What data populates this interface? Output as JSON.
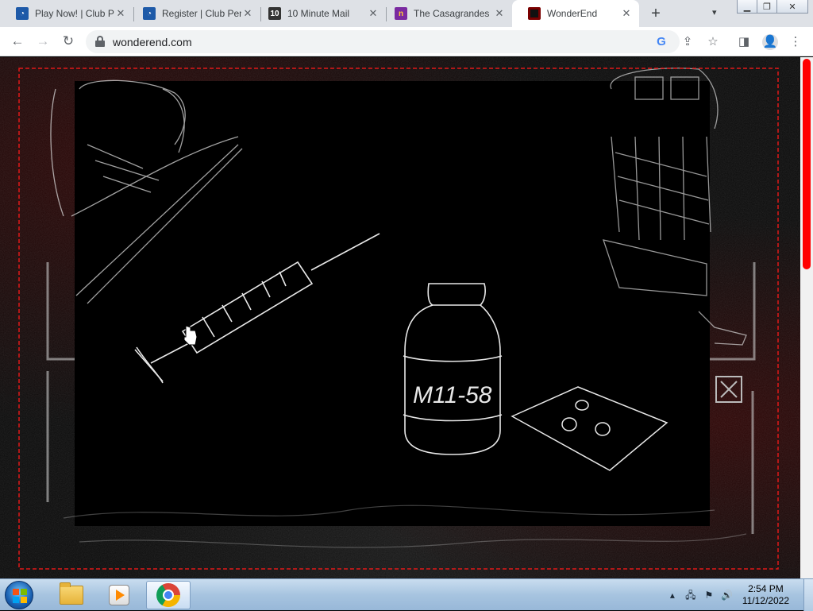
{
  "browser": {
    "tabs": [
      {
        "title": "Play Now! | Club Penguin",
        "favicon": "club-penguin-icon",
        "active": false
      },
      {
        "title": "Register | Club Penguin",
        "favicon": "club-penguin-icon",
        "active": false
      },
      {
        "title": "10 Minute Mail",
        "favicon": "10-minute-mail-icon",
        "favicon_text": "10",
        "active": false
      },
      {
        "title": "The Casagrandes",
        "favicon": "casagrandes-icon",
        "active": false
      },
      {
        "title": "WonderEnd",
        "favicon": "wonderend-icon",
        "active": true
      }
    ],
    "new_tab_glyph": "+",
    "tab_close_glyph": "✕",
    "url": "wonderend.com"
  },
  "game": {
    "scene_label": "M11-58",
    "accent_color": "#ff0000",
    "border_color": "#e01818"
  },
  "taskbar": {
    "pinned": [
      "windows-explorer-icon",
      "media-player-icon",
      "chrome-icon"
    ],
    "clock_time": "2:54 PM",
    "clock_date": "11/12/2022"
  }
}
